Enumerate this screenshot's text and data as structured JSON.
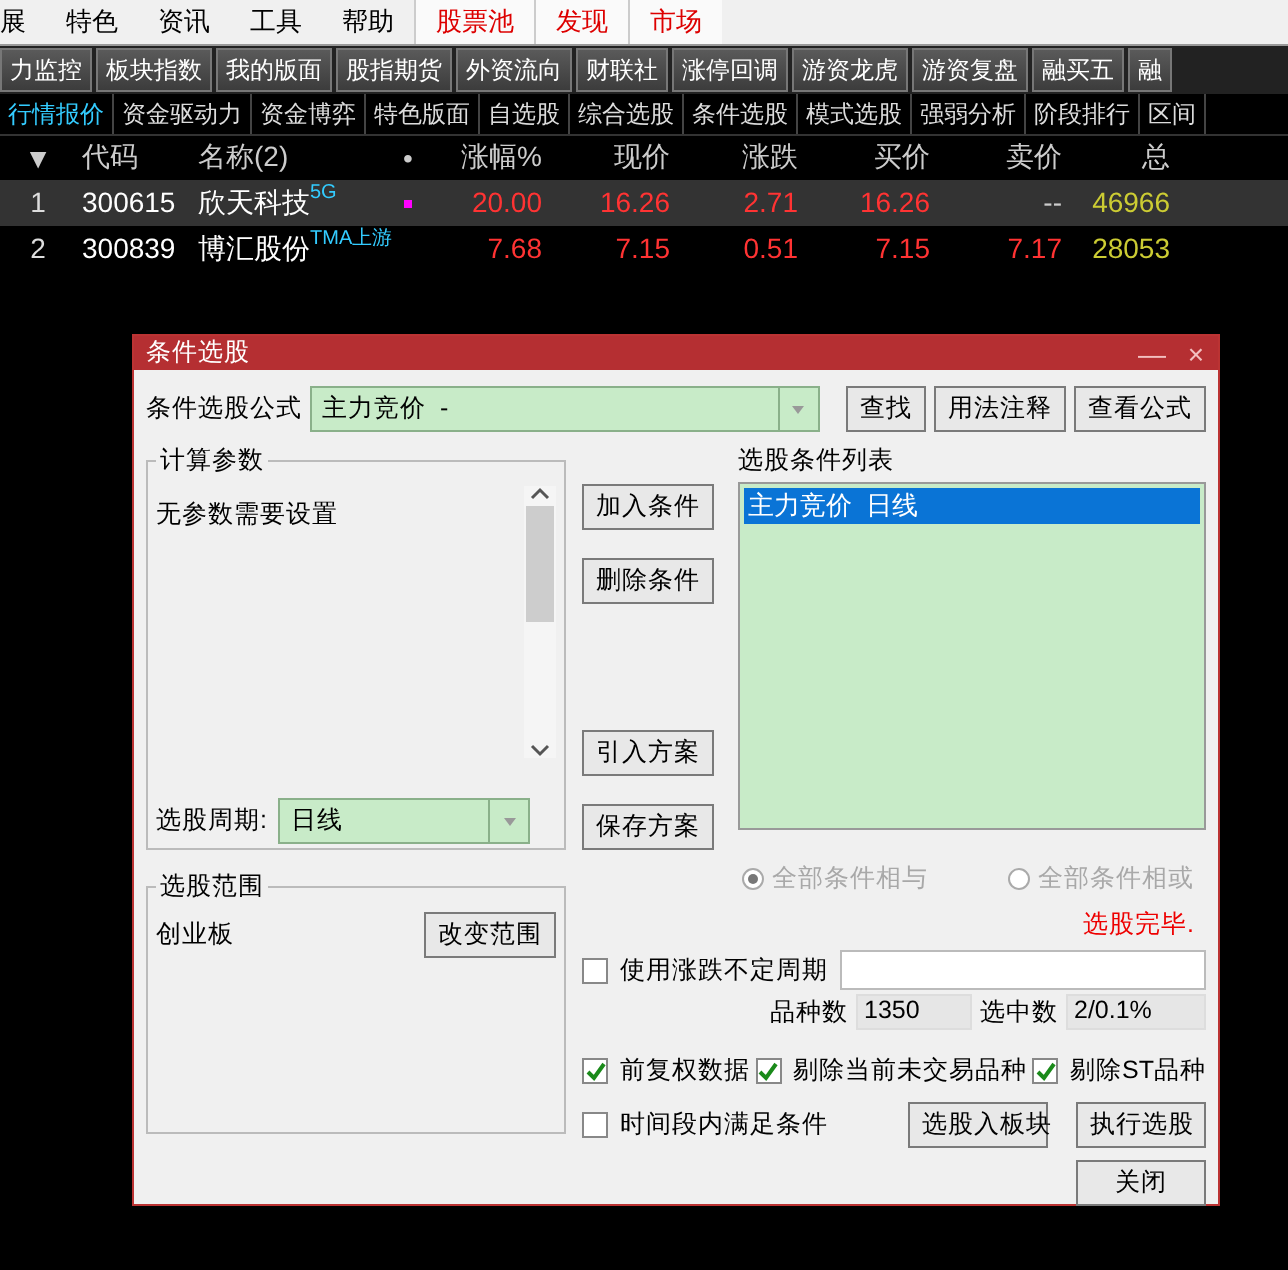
{
  "menu": [
    {
      "label": "展",
      "highlight": false
    },
    {
      "label": "特色",
      "highlight": false
    },
    {
      "label": "资讯",
      "highlight": false
    },
    {
      "label": "工具",
      "highlight": false
    },
    {
      "label": "帮助",
      "highlight": false
    },
    {
      "label": "股票池",
      "highlight": true
    },
    {
      "label": "发现",
      "highlight": true
    },
    {
      "label": "市场",
      "highlight": true
    }
  ],
  "toolbar": [
    "力监控",
    "板块指数",
    "我的版面",
    "股指期货",
    "外资流向",
    "财联社",
    "涨停回调",
    "游资龙虎",
    "游资复盘",
    "融买五",
    "融"
  ],
  "tabs": [
    {
      "label": "行情报价",
      "selected": true
    },
    {
      "label": "资金驱动力",
      "selected": false
    },
    {
      "label": "资金博弈",
      "selected": false
    },
    {
      "label": "特色版面",
      "selected": false
    },
    {
      "label": "自选股",
      "selected": false
    },
    {
      "label": "综合选股",
      "selected": false
    },
    {
      "label": "条件选股",
      "selected": false
    },
    {
      "label": "模式选股",
      "selected": false
    },
    {
      "label": "强弱分析",
      "selected": false
    },
    {
      "label": "阶段排行",
      "selected": false
    },
    {
      "label": "区间",
      "selected": false
    }
  ],
  "table": {
    "columns": [
      "▼",
      "代码",
      "名称(2)",
      "•",
      "涨幅%",
      "现价",
      "涨跌",
      "买价",
      "卖价",
      "总"
    ],
    "rows": [
      {
        "index": "1",
        "code": "300615",
        "name": "欣天科技",
        "tag": "5G",
        "flag": true,
        "selected": true,
        "change_pct": "20.00",
        "price": "16.26",
        "change": "2.71",
        "bid": "16.26",
        "ask": "--",
        "volume": "46966"
      },
      {
        "index": "2",
        "code": "300839",
        "name": "博汇股份",
        "tag": "TMA上游",
        "flag": false,
        "selected": false,
        "change_pct": "7.68",
        "price": "7.15",
        "change": "0.51",
        "bid": "7.15",
        "ask": "7.17",
        "volume": "28053"
      }
    ]
  },
  "dialog": {
    "title": "条件选股",
    "minimize": "—",
    "close": "×",
    "formula_label": "条件选股公式",
    "formula_value": "主力竞价  -",
    "formula_buttons": [
      "查找",
      "用法注释",
      "查看公式"
    ],
    "params_group": "计算参数",
    "params_text": "无参数需要设置",
    "period_label": "选股周期:",
    "period_value": "日线",
    "action_buttons": [
      "加入条件",
      "删除条件",
      "引入方案",
      "保存方案"
    ],
    "list_label": "选股条件列表",
    "list_items": [
      {
        "label": "主力竞价  日线",
        "selected": true
      }
    ],
    "combine": [
      {
        "label": "全部条件相与",
        "selected": true,
        "disabled": true
      },
      {
        "label": "全部条件相或",
        "selected": false,
        "disabled": true
      }
    ],
    "status": "选股完毕.",
    "range_group": "选股范围",
    "range_value": "创业板",
    "range_button": "改变范围",
    "uncertain_period": {
      "label": "使用涨跌不定周期",
      "checked": false
    },
    "count_label": "品种数",
    "count_value": "1350",
    "selected_label": "选中数",
    "selected_value": "2/0.1%",
    "options": [
      {
        "label": "前复权数据",
        "checked": true
      },
      {
        "label": "剔除当前未交易品种",
        "checked": true
      },
      {
        "label": "剔除ST品种",
        "checked": true
      }
    ],
    "time_condition": {
      "label": "时间段内满足条件",
      "checked": false
    },
    "bottom_buttons": [
      "选股入板块",
      "执行选股",
      "关闭"
    ]
  }
}
